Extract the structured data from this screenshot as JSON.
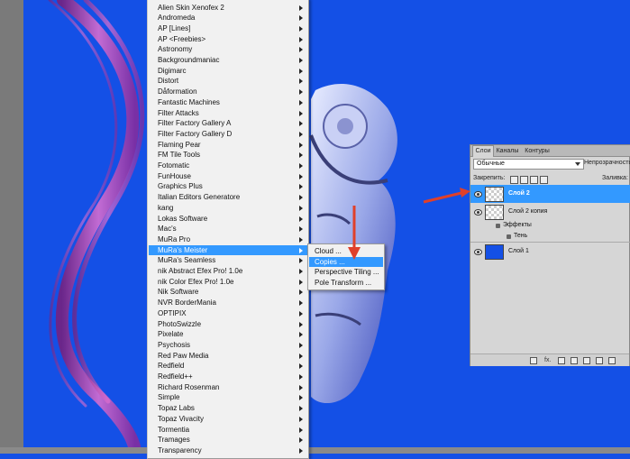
{
  "colors": {
    "canvas_bg": "#1450e6",
    "highlight": "#3399ff",
    "arrow": "#e0402a"
  },
  "filter_menu": {
    "items": [
      {
        "label": "Alien Skin Xenofex 2"
      },
      {
        "label": "Andromeda"
      },
      {
        "label": "AP [Lines]"
      },
      {
        "label": "AP <Freebies>"
      },
      {
        "label": "Astronomy"
      },
      {
        "label": "Backgroundmaniac"
      },
      {
        "label": "Digimarc"
      },
      {
        "label": "Distort"
      },
      {
        "label": "Dåformation"
      },
      {
        "label": "Fantastic Machines"
      },
      {
        "label": "Filter Attacks"
      },
      {
        "label": "Filter Factory Gallery A"
      },
      {
        "label": "Filter Factory Gallery D"
      },
      {
        "label": "Flaming Pear"
      },
      {
        "label": "FM Tile Tools"
      },
      {
        "label": "Fotomatic"
      },
      {
        "label": "FunHouse"
      },
      {
        "label": "Graphics Plus"
      },
      {
        "label": "Italian Editors Generatore"
      },
      {
        "label": "kang"
      },
      {
        "label": "Lokas Software"
      },
      {
        "label": "Mac's"
      },
      {
        "label": "MuRa Pro"
      },
      {
        "label": "MuRa's Meister"
      },
      {
        "label": "MuRa's Seamless"
      },
      {
        "label": "nik Abstract Efex Pro! 1.0e"
      },
      {
        "label": "nik Color Efex Pro! 1.0e"
      },
      {
        "label": "Nik Software"
      },
      {
        "label": "NVR BorderMania"
      },
      {
        "label": "OPTIPIX"
      },
      {
        "label": "PhotoSwizzle"
      },
      {
        "label": "Pixelate"
      },
      {
        "label": "Psychosis"
      },
      {
        "label": "Red Paw Media"
      },
      {
        "label": "Redfield"
      },
      {
        "label": "Redfield++"
      },
      {
        "label": "Richard Rosenman"
      },
      {
        "label": "Simple"
      },
      {
        "label": "Topaz Labs"
      },
      {
        "label": "Topaz Vivacity"
      },
      {
        "label": "Tormentia"
      },
      {
        "label": "Tramages"
      },
      {
        "label": "Transparency"
      }
    ],
    "selected_label": "MuRa's Meister"
  },
  "submenu": {
    "items": [
      {
        "label": "Cloud ..."
      },
      {
        "label": "Copies ..."
      },
      {
        "label": "Perspective Tiling ..."
      },
      {
        "label": "Pole Transform ..."
      }
    ],
    "selected_label": "Copies ..."
  },
  "layers_panel": {
    "tabs": [
      {
        "label": "Слои"
      },
      {
        "label": "Каналы"
      },
      {
        "label": "Контуры"
      }
    ],
    "blend_mode": "Обычные",
    "opacity_label": "Непрозрачность:",
    "lock_label": "Закрепить:",
    "fill_label": "Заливка:",
    "layers": [
      {
        "name": "Слой 2",
        "selected": true
      },
      {
        "name": "Слой 2 копия",
        "selected": false
      },
      {
        "name": "Слой 1",
        "selected": false
      }
    ],
    "effects_label": "Эффекты",
    "shadow_label": "Тень",
    "bottom_fx": "fx."
  }
}
